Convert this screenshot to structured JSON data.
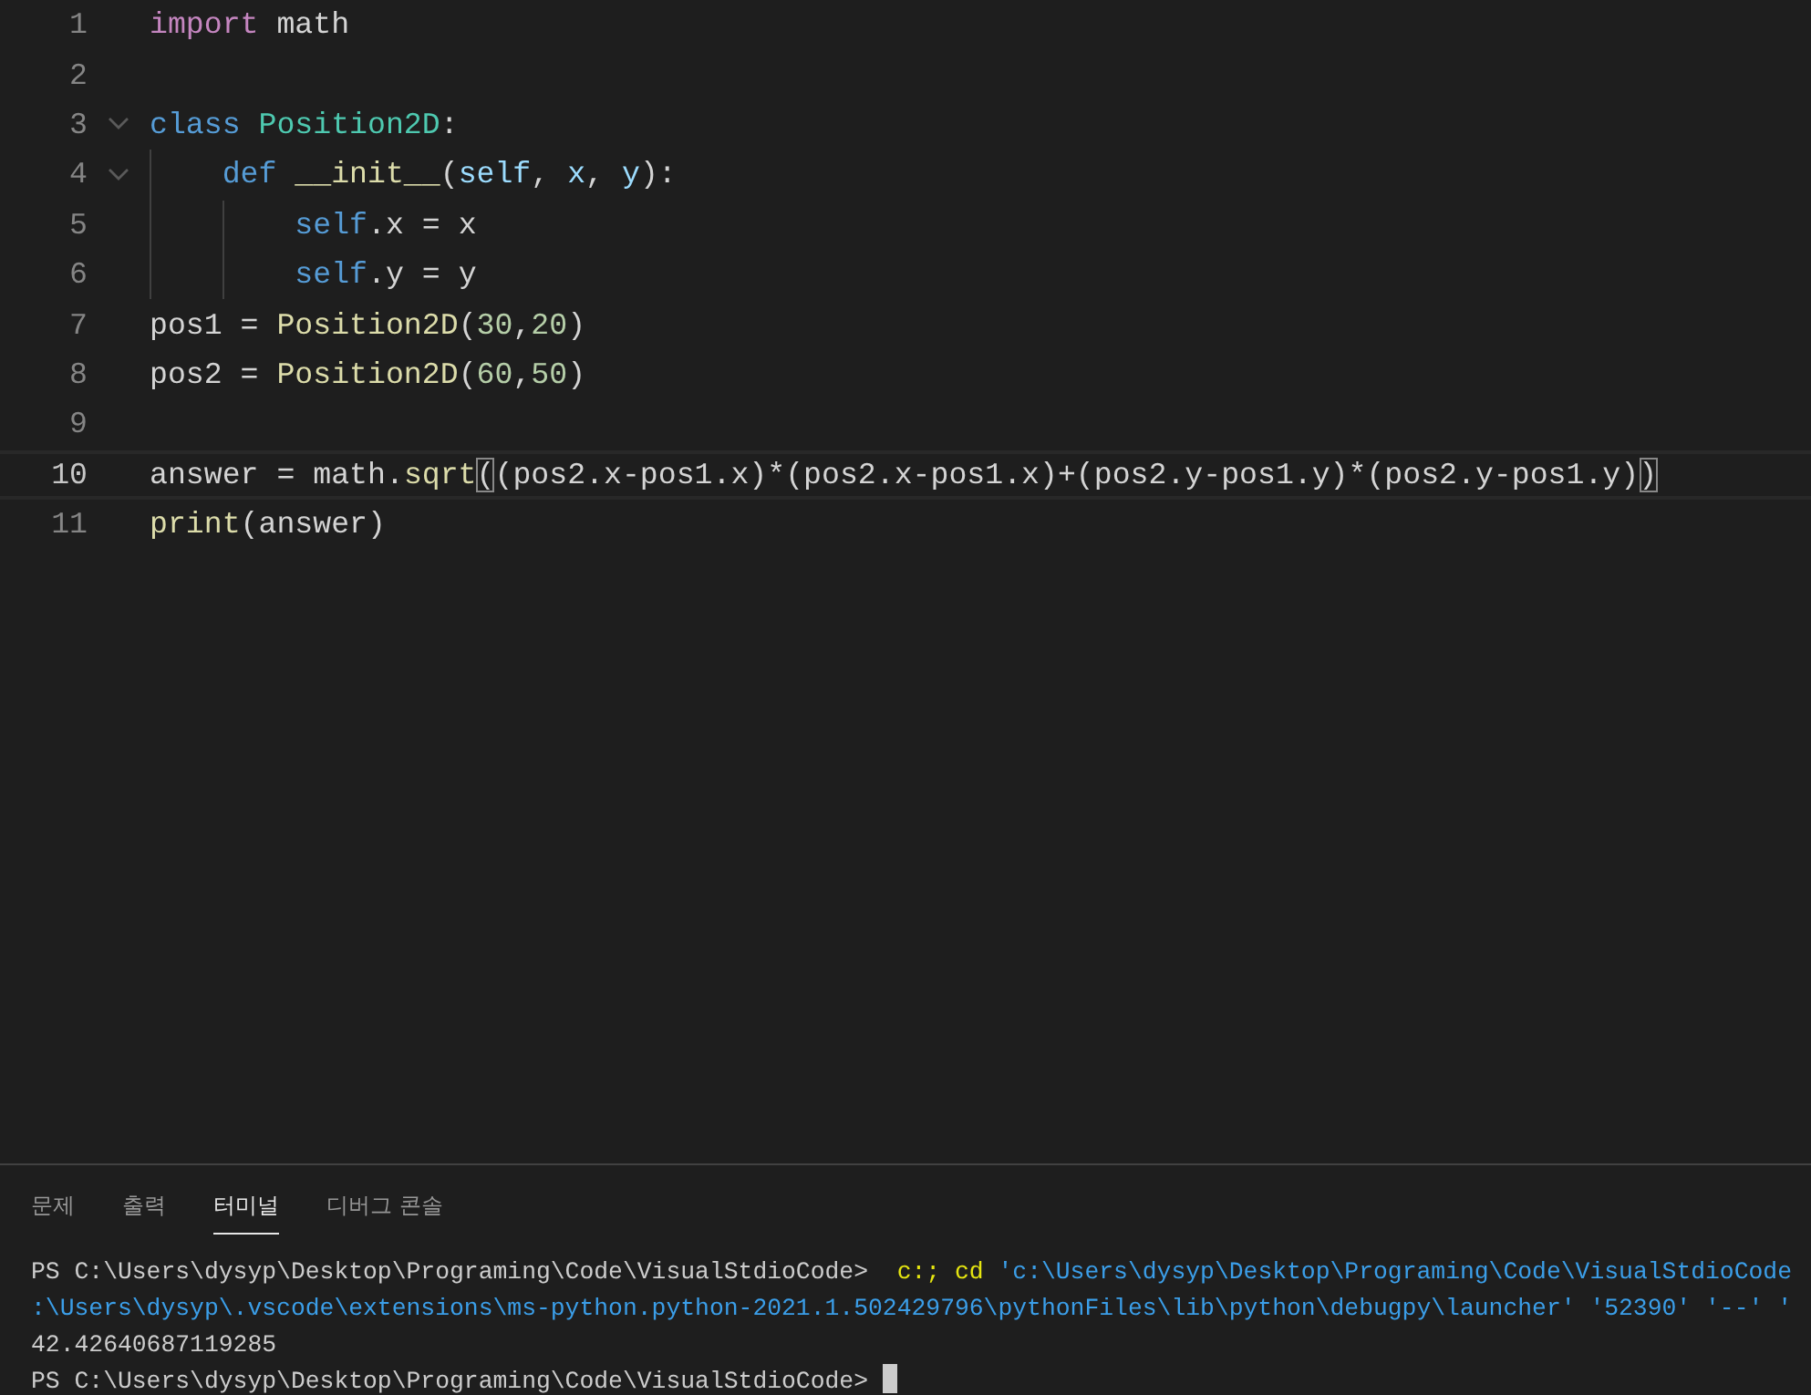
{
  "editor": {
    "lines": [
      {
        "number": "1",
        "current": false,
        "foldable": false,
        "tokens": [
          {
            "text": "import",
            "kind": "keyword"
          },
          {
            "text": " math",
            "kind": "plain"
          }
        ]
      },
      {
        "number": "2",
        "current": false,
        "foldable": false
      },
      {
        "number": "3",
        "current": false,
        "foldable": true,
        "tokens": [
          {
            "text": "class",
            "kind": "storage"
          },
          {
            "text": " Position2D",
            "kind": "type"
          },
          {
            "text": ":",
            "kind": "plain"
          }
        ]
      },
      {
        "number": "4",
        "current": false,
        "foldable": true,
        "tokens": [
          {
            "text": "    def",
            "kind": "storage"
          },
          {
            "text": " __init__",
            "kind": "function"
          },
          {
            "text": "(",
            "kind": "plain"
          },
          {
            "text": "self",
            "kind": "param"
          },
          {
            "text": ", ",
            "kind": "plain"
          },
          {
            "text": "x",
            "kind": "param"
          },
          {
            "text": ", ",
            "kind": "plain"
          },
          {
            "text": "y",
            "kind": "param"
          },
          {
            "text": "):",
            "kind": "plain"
          }
        ]
      },
      {
        "number": "5",
        "current": false,
        "foldable": false,
        "tokens": [
          {
            "text": "        self",
            "kind": "storage"
          },
          {
            "text": ".",
            "kind": "plain"
          },
          {
            "text": "x",
            "kind": "variable"
          },
          {
            "text": " = ",
            "kind": "plain"
          },
          {
            "text": "x",
            "kind": "variable"
          }
        ]
      },
      {
        "number": "6",
        "current": false,
        "foldable": false,
        "tokens": [
          {
            "text": "        self",
            "kind": "storage"
          },
          {
            "text": ".",
            "kind": "plain"
          },
          {
            "text": "y",
            "kind": "variable"
          },
          {
            "text": " = ",
            "kind": "plain"
          },
          {
            "text": "y",
            "kind": "variable"
          }
        ]
      },
      {
        "number": "7",
        "current": false,
        "foldable": false,
        "tokens": [
          {
            "text": "pos1",
            "kind": "variable"
          },
          {
            "text": " = ",
            "kind": "plain"
          },
          {
            "text": "Position2D",
            "kind": "function"
          },
          {
            "text": "(",
            "kind": "plain"
          },
          {
            "text": "30",
            "kind": "number"
          },
          {
            "text": ",",
            "kind": "plain"
          },
          {
            "text": "20",
            "kind": "number"
          },
          {
            "text": ")",
            "kind": "plain"
          }
        ]
      },
      {
        "number": "8",
        "current": false,
        "foldable": false,
        "tokens": [
          {
            "text": "pos2",
            "kind": "variable"
          },
          {
            "text": " = ",
            "kind": "plain"
          },
          {
            "text": "Position2D",
            "kind": "function"
          },
          {
            "text": "(",
            "kind": "plain"
          },
          {
            "text": "60",
            "kind": "number"
          },
          {
            "text": ",",
            "kind": "plain"
          },
          {
            "text": "50",
            "kind": "number"
          },
          {
            "text": ")",
            "kind": "plain"
          }
        ]
      },
      {
        "number": "9",
        "current": false,
        "foldable": false
      },
      {
        "number": "10",
        "current": true,
        "foldable": false,
        "tokens": [
          {
            "text": "answer",
            "kind": "variable"
          },
          {
            "text": " = ",
            "kind": "plain"
          },
          {
            "text": "math",
            "kind": "variable"
          },
          {
            "text": ".",
            "kind": "plain"
          },
          {
            "text": "sqrt",
            "kind": "function"
          },
          {
            "text": "(",
            "kind": "bracket-match"
          },
          {
            "text": "(pos2.x-pos1.x)*(pos2.x-pos1.x)+(pos2.y-pos1.y)*(pos2.y-pos1.y)",
            "kind": "variable"
          },
          {
            "text": ")",
            "kind": "bracket-match"
          }
        ]
      },
      {
        "number": "11",
        "current": false,
        "foldable": false,
        "tokens": [
          {
            "text": "print",
            "kind": "function"
          },
          {
            "text": "(",
            "kind": "plain"
          },
          {
            "text": "answer",
            "kind": "variable"
          },
          {
            "text": ")",
            "kind": "plain"
          }
        ]
      }
    ]
  },
  "panel": {
    "tabs": [
      {
        "label": "문제",
        "selected": false
      },
      {
        "label": "출력",
        "selected": false
      },
      {
        "label": "터미널",
        "selected": true
      },
      {
        "label": "디버그 콘솔",
        "selected": false
      }
    ],
    "terminal": {
      "lines": [
        {
          "segments": [
            {
              "text": "PS C:\\Users\\dysyp\\Desktop\\Programing\\Code\\VisualStdioCode> ",
              "kind": "plain"
            },
            {
              "text": " c:; cd",
              "kind": "command"
            },
            {
              "text": " 'c:\\Users\\dysyp\\Desktop\\Programing\\Code\\VisualStdioCode",
              "kind": "string"
            }
          ]
        },
        {
          "segments": [
            {
              "text": ":\\Users\\dysyp\\.vscode\\extensions\\ms-python.python-2021.1.502429796\\pythonFiles\\lib\\python\\debugpy\\launcher' '52390' '--' '",
              "kind": "string"
            }
          ]
        },
        {
          "segments": [
            {
              "text": "42.42640687119285",
              "kind": "plain"
            }
          ]
        },
        {
          "segments": [
            {
              "text": "PS C:\\Users\\dysyp\\Desktop\\Programing\\Code\\VisualStdioCode> ",
              "kind": "plain"
            }
          ],
          "cursor": true
        }
      ]
    }
  }
}
